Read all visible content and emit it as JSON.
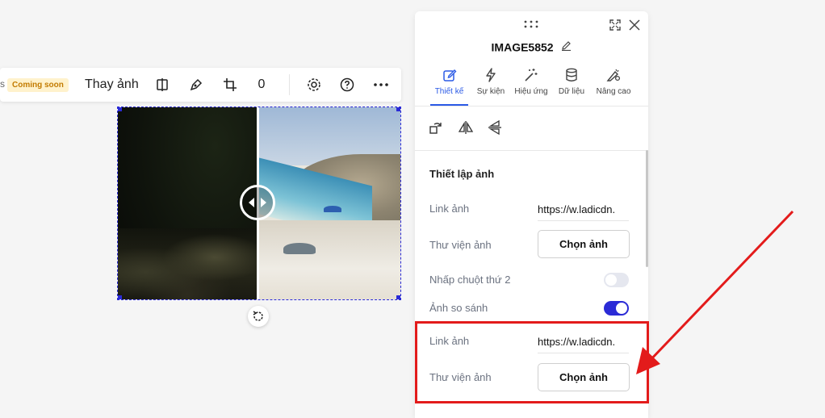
{
  "toolbar": {
    "cut_text": "s",
    "badge": "Coming soon",
    "replace_label": "Thay ảnh",
    "count": "0"
  },
  "panel": {
    "title": "IMAGE5852",
    "tabs": [
      {
        "label": "Thiết kế",
        "icon": "edit-icon",
        "active": true
      },
      {
        "label": "Sự kiện",
        "icon": "lightning-icon",
        "active": false
      },
      {
        "label": "Hiệu ứng",
        "icon": "magic-wand-icon",
        "active": false
      },
      {
        "label": "Dữ liệu",
        "icon": "database-icon",
        "active": false
      },
      {
        "label": "Nâng cao",
        "icon": "advanced-settings-icon",
        "active": false
      }
    ],
    "section_title": "Thiết lập ảnh",
    "link_label_1": "Link ảnh",
    "link_value_1": "https://w.ladicdn.",
    "library_label_1": "Thư viện ảnh",
    "choose_button_1": "Chọn ảnh",
    "second_click_label": "Nhấp chuột thứ 2",
    "second_click_on": false,
    "compare_label": "Ảnh so sánh",
    "compare_on": true,
    "link_label_2": "Link ảnh",
    "link_value_2": "https://w.ladicdn.",
    "library_label_2": "Thư viện ảnh",
    "choose_button_2": "Chọn ảnh"
  },
  "colors": {
    "accent": "#2b5ae6",
    "toggle_on": "#2b2bd6",
    "highlight": "#e31b1b",
    "badge_bg": "#fff2cc",
    "badge_text": "#c27b00"
  }
}
